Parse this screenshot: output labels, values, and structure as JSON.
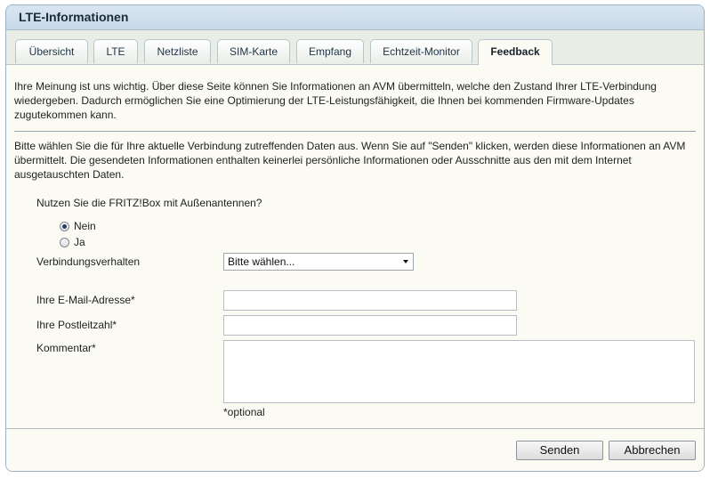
{
  "window": {
    "title": "LTE-Informationen"
  },
  "tabs": [
    {
      "label": "Übersicht"
    },
    {
      "label": "LTE"
    },
    {
      "label": "Netzliste"
    },
    {
      "label": "SIM-Karte"
    },
    {
      "label": "Empfang"
    },
    {
      "label": "Echtzeit-Monitor"
    },
    {
      "label": "Feedback",
      "active": true
    }
  ],
  "intro1": "Ihre Meinung ist uns wichtig. Über diese Seite können Sie Informationen an AVM übermitteln, welche den Zustand Ihrer LTE-Verbindung wiedergeben. Dadurch ermöglichen Sie eine Optimierung der LTE-Leistungsfähigkeit, die Ihnen bei kommenden Firmware-Updates zugutekommen kann.",
  "intro2": "Bitte wählen Sie die für Ihre aktuelle Verbindung zutreffenden Daten aus. Wenn Sie auf \"Senden\" klicken, werden diese Informationen an AVM übermittelt. Die gesendeten Informationen enthalten keinerlei persönliche Informationen oder Ausschnitte aus den mit dem Internet ausgetauschten Daten.",
  "form": {
    "antenna_question": "Nutzen Sie die FRITZ!Box mit Außenantennen?",
    "radio_no": "Nein",
    "radio_yes": "Ja",
    "selected": "Nein",
    "connection_label": "Verbindungsverhalten",
    "connection_value": "Bitte wählen...",
    "email_label": "Ihre E-Mail-Adresse*",
    "email_value": "",
    "zip_label": "Ihre Postleitzahl*",
    "zip_value": "",
    "comment_label": "Kommentar*",
    "comment_value": "",
    "optional_note": "*optional"
  },
  "buttons": {
    "send": "Senden",
    "cancel": "Abbrechen"
  }
}
